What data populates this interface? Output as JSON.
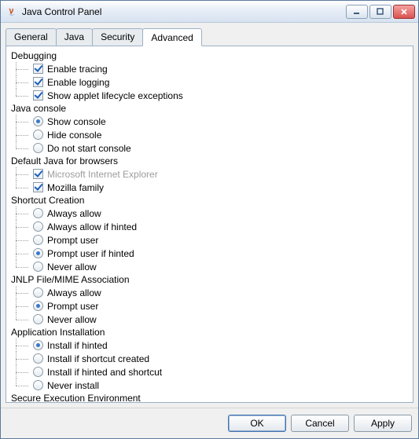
{
  "window": {
    "title": "Java Control Panel"
  },
  "tabs": [
    {
      "label": "General",
      "active": false
    },
    {
      "label": "Java",
      "active": false
    },
    {
      "label": "Security",
      "active": false
    },
    {
      "label": "Advanced",
      "active": true
    }
  ],
  "sections": [
    {
      "heading": "Debugging",
      "type": "checkbox",
      "items": [
        {
          "label": "Enable tracing",
          "checked": true
        },
        {
          "label": "Enable logging",
          "checked": true
        },
        {
          "label": "Show applet lifecycle exceptions",
          "checked": true
        }
      ]
    },
    {
      "heading": "Java console",
      "type": "radio",
      "items": [
        {
          "label": "Show console",
          "checked": true
        },
        {
          "label": "Hide console",
          "checked": false
        },
        {
          "label": "Do not start console",
          "checked": false
        }
      ]
    },
    {
      "heading": "Default Java for browsers",
      "type": "checkbox",
      "items": [
        {
          "label": "Microsoft Internet Explorer",
          "checked": true,
          "disabled": true
        },
        {
          "label": "Mozilla family",
          "checked": true
        }
      ]
    },
    {
      "heading": "Shortcut Creation",
      "type": "radio",
      "items": [
        {
          "label": "Always allow",
          "checked": false
        },
        {
          "label": "Always allow if hinted",
          "checked": false
        },
        {
          "label": "Prompt user",
          "checked": false
        },
        {
          "label": "Prompt user if hinted",
          "checked": true
        },
        {
          "label": "Never allow",
          "checked": false
        }
      ]
    },
    {
      "heading": "JNLP File/MIME Association",
      "type": "radio",
      "items": [
        {
          "label": "Always allow",
          "checked": false
        },
        {
          "label": "Prompt user",
          "checked": true
        },
        {
          "label": "Never allow",
          "checked": false
        }
      ]
    },
    {
      "heading": "Application Installation",
      "type": "radio",
      "items": [
        {
          "label": "Install if hinted",
          "checked": true
        },
        {
          "label": "Install if shortcut created",
          "checked": false
        },
        {
          "label": "Install if hinted and shortcut",
          "checked": false
        },
        {
          "label": "Never install",
          "checked": false
        }
      ]
    },
    {
      "heading": "Secure Execution Environment",
      "type": "checkbox",
      "items": []
    }
  ],
  "buttons": {
    "ok": "OK",
    "cancel": "Cancel",
    "apply": "Apply"
  }
}
